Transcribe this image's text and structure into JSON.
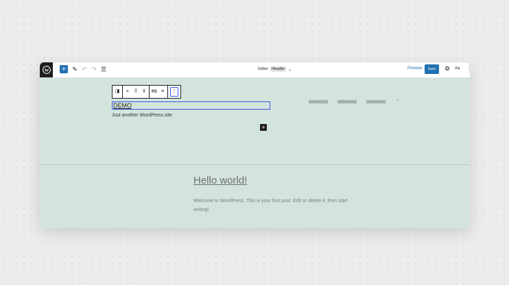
{
  "toolbar": {
    "document_title": "Index",
    "document_badge": "Header",
    "preview_label": "Preview",
    "save_label": "Save",
    "styles_label": "Aa"
  },
  "block_toolbar": {
    "heading_level": "H1"
  },
  "header": {
    "site_title": "DEMO",
    "tagline": "Just another WordPress site"
  },
  "post": {
    "title": "Hello world!",
    "excerpt": "Welcome to WordPress. This is your first post. Edit or delete it, then start writing!"
  },
  "colors": {
    "accent": "#2271b1",
    "canvas": "#d3e4dc",
    "selection": "#3858e9"
  }
}
